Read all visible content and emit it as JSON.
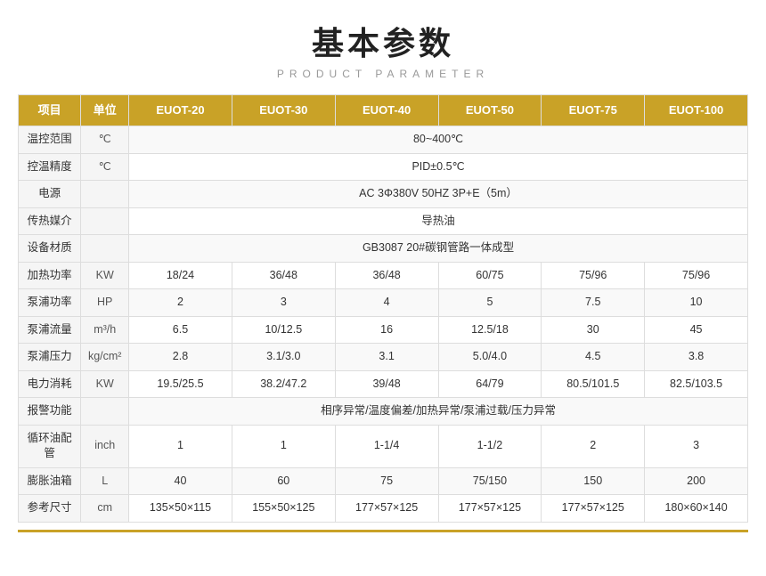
{
  "title": "基本参数",
  "subtitle": "PRODUCT PARAMETER",
  "table": {
    "headers": [
      "项目",
      "单位",
      "EUOT-20",
      "EUOT-30",
      "EUOT-40",
      "EUOT-50",
      "EUOT-75",
      "EUOT-100"
    ],
    "rows": [
      {
        "label": "温控范围",
        "unit": "℃",
        "values": [
          "80~400℃",
          "",
          "",
          "",
          "",
          ""
        ],
        "colspan": true
      },
      {
        "label": "控温精度",
        "unit": "℃",
        "values": [
          "PID±0.5℃",
          "",
          "",
          "",
          "",
          ""
        ],
        "colspan": true
      },
      {
        "label": "电源",
        "unit": "",
        "values": [
          "AC 3Φ380V 50HZ  3P+E（5m）",
          "",
          "",
          "",
          "",
          ""
        ],
        "colspan": true
      },
      {
        "label": "传热媒介",
        "unit": "",
        "values": [
          "导热油",
          "",
          "",
          "",
          "",
          ""
        ],
        "colspan": true
      },
      {
        "label": "设备材质",
        "unit": "",
        "values": [
          "GB3087   20#碳钢管路一体成型",
          "",
          "",
          "",
          "",
          ""
        ],
        "colspan": true
      },
      {
        "label": "加热功率",
        "unit": "KW",
        "values": [
          "18/24",
          "36/48",
          "36/48",
          "60/75",
          "75/96",
          "75/96"
        ],
        "colspan": false
      },
      {
        "label": "泵浦功率",
        "unit": "HP",
        "values": [
          "2",
          "3",
          "4",
          "5",
          "7.5",
          "10"
        ],
        "colspan": false
      },
      {
        "label": "泵浦流量",
        "unit": "m³/h",
        "values": [
          "6.5",
          "10/12.5",
          "16",
          "12.5/18",
          "30",
          "45"
        ],
        "colspan": false
      },
      {
        "label": "泵浦压力",
        "unit": "kg/cm²",
        "values": [
          "2.8",
          "3.1/3.0",
          "3.1",
          "5.0/4.0",
          "4.5",
          "3.8"
        ],
        "colspan": false
      },
      {
        "label": "电力消耗",
        "unit": "KW",
        "values": [
          "19.5/25.5",
          "38.2/47.2",
          "39/48",
          "64/79",
          "80.5/101.5",
          "82.5/103.5"
        ],
        "colspan": false
      },
      {
        "label": "报警功能",
        "unit": "",
        "values": [
          "相序异常/温度偏差/加热异常/泵浦过载/压力异常",
          "",
          "",
          "",
          "",
          ""
        ],
        "colspan": true
      },
      {
        "label": "循环油配管",
        "unit": "inch",
        "values": [
          "1",
          "1",
          "1-1/4",
          "1-1/2",
          "2",
          "3"
        ],
        "colspan": false
      },
      {
        "label": "膨胀油箱",
        "unit": "L",
        "values": [
          "40",
          "60",
          "75",
          "75/150",
          "150",
          "200"
        ],
        "colspan": false
      },
      {
        "label": "参考尺寸",
        "unit": "cm",
        "values": [
          "135×50×115",
          "155×50×125",
          "177×57×125",
          "177×57×125",
          "177×57×125",
          "180×60×140"
        ],
        "colspan": false
      }
    ]
  }
}
